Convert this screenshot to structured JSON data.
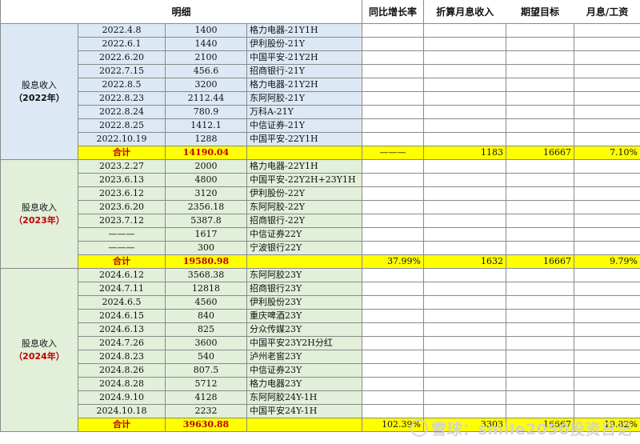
{
  "headers": {
    "detail": "明细",
    "yoy": "同比增长率",
    "monthly": "折算月息收入",
    "target": "期望目标",
    "ratio": "月息/工资"
  },
  "groups": [
    {
      "label": "股息收入",
      "year": "（2022年）",
      "rows": [
        {
          "date": "2022.4.8",
          "amount": "1400",
          "name": "格力电器-21Y1H"
        },
        {
          "date": "2022.6.1",
          "amount": "1440",
          "name": "伊利股份-21Y"
        },
        {
          "date": "2022.6.20",
          "amount": "2100",
          "name": "中国平安-21Y2H"
        },
        {
          "date": "2022.7.15",
          "amount": "456.6",
          "name": "招商银行-21Y"
        },
        {
          "date": "2022.8.5",
          "amount": "3200",
          "name": "格力电器-21Y2H"
        },
        {
          "date": "2022.8.23",
          "amount": "2112.44",
          "name": "东阿阿胶-21Y"
        },
        {
          "date": "2022.8.24",
          "amount": "780.9",
          "name": "万科A-21Y"
        },
        {
          "date": "2022.8.25",
          "amount": "1412.1",
          "name": "中信证券-21Y"
        },
        {
          "date": "2022.10.19",
          "amount": "1288",
          "name": "中国平安-22Y1H"
        }
      ],
      "total": {
        "label": "合计",
        "amount": "14190.04",
        "yoy": "———",
        "monthly": "1183",
        "target": "16667",
        "ratio": "7.10%"
      }
    },
    {
      "label": "股息收入",
      "year": "（2023年）",
      "rows": [
        {
          "date": "2023.2.27",
          "amount": "2000",
          "name": "格力电器-22Y1H"
        },
        {
          "date": "2023.6.13",
          "amount": "4800",
          "name": "中国平安-22Y2H+23Y1H"
        },
        {
          "date": "2023.6.12",
          "amount": "3120",
          "name": "伊利股份-22Y"
        },
        {
          "date": "2023.6.20",
          "amount": "2356.18",
          "name": "东阿阿胶-22Y"
        },
        {
          "date": "2023.7.12",
          "amount": "5387.8",
          "name": "招商银行-22Y"
        },
        {
          "date": "———",
          "amount": "1617",
          "name": "中信证券22Y"
        },
        {
          "date": "———",
          "amount": "300",
          "name": "宁波银行22Y"
        }
      ],
      "total": {
        "label": "合计",
        "amount": "19580.98",
        "yoy": "37.99%",
        "monthly": "1632",
        "target": "16667",
        "ratio": "9.79%"
      }
    },
    {
      "label": "股息收入",
      "year": "（2024年）",
      "rows": [
        {
          "date": "2024.6.12",
          "amount": "3568.38",
          "name": "东阿阿胶23Y"
        },
        {
          "date": "2024.7.11",
          "amount": "12818",
          "name": "招商银行23Y"
        },
        {
          "date": "2024.6.5",
          "amount": "4560",
          "name": "伊利股份23Y"
        },
        {
          "date": "2024.6.15",
          "amount": "840",
          "name": "重庆啤酒23Y"
        },
        {
          "date": "2024.6.13",
          "amount": "825",
          "name": "分众传媒23Y"
        },
        {
          "date": "2024.7.26",
          "amount": "3600",
          "name": "中国平安23Y2H分红"
        },
        {
          "date": "2024.8.23",
          "amount": "540",
          "name": "泸州老窖23Y"
        },
        {
          "date": "2024.8.26",
          "amount": "807.5",
          "name": "中信证券23Y"
        },
        {
          "date": "2024.8.28",
          "amount": "5712",
          "name": "格力电器23Y"
        },
        {
          "date": "2024.9.10",
          "amount": "4128",
          "name": "东阿阿胶24Y-1H"
        },
        {
          "date": "2024.10.18",
          "amount": "2232",
          "name": "中国平安24Y-1H"
        }
      ],
      "total": {
        "label": "合计",
        "amount": "39630.88",
        "yoy": "102.39%",
        "monthly": "3303",
        "target": "16667",
        "ratio": "19.82%"
      }
    }
  ],
  "watermark": "雪球：smile2050投资日记",
  "watermark_icon": "snowball-logo-icon"
}
